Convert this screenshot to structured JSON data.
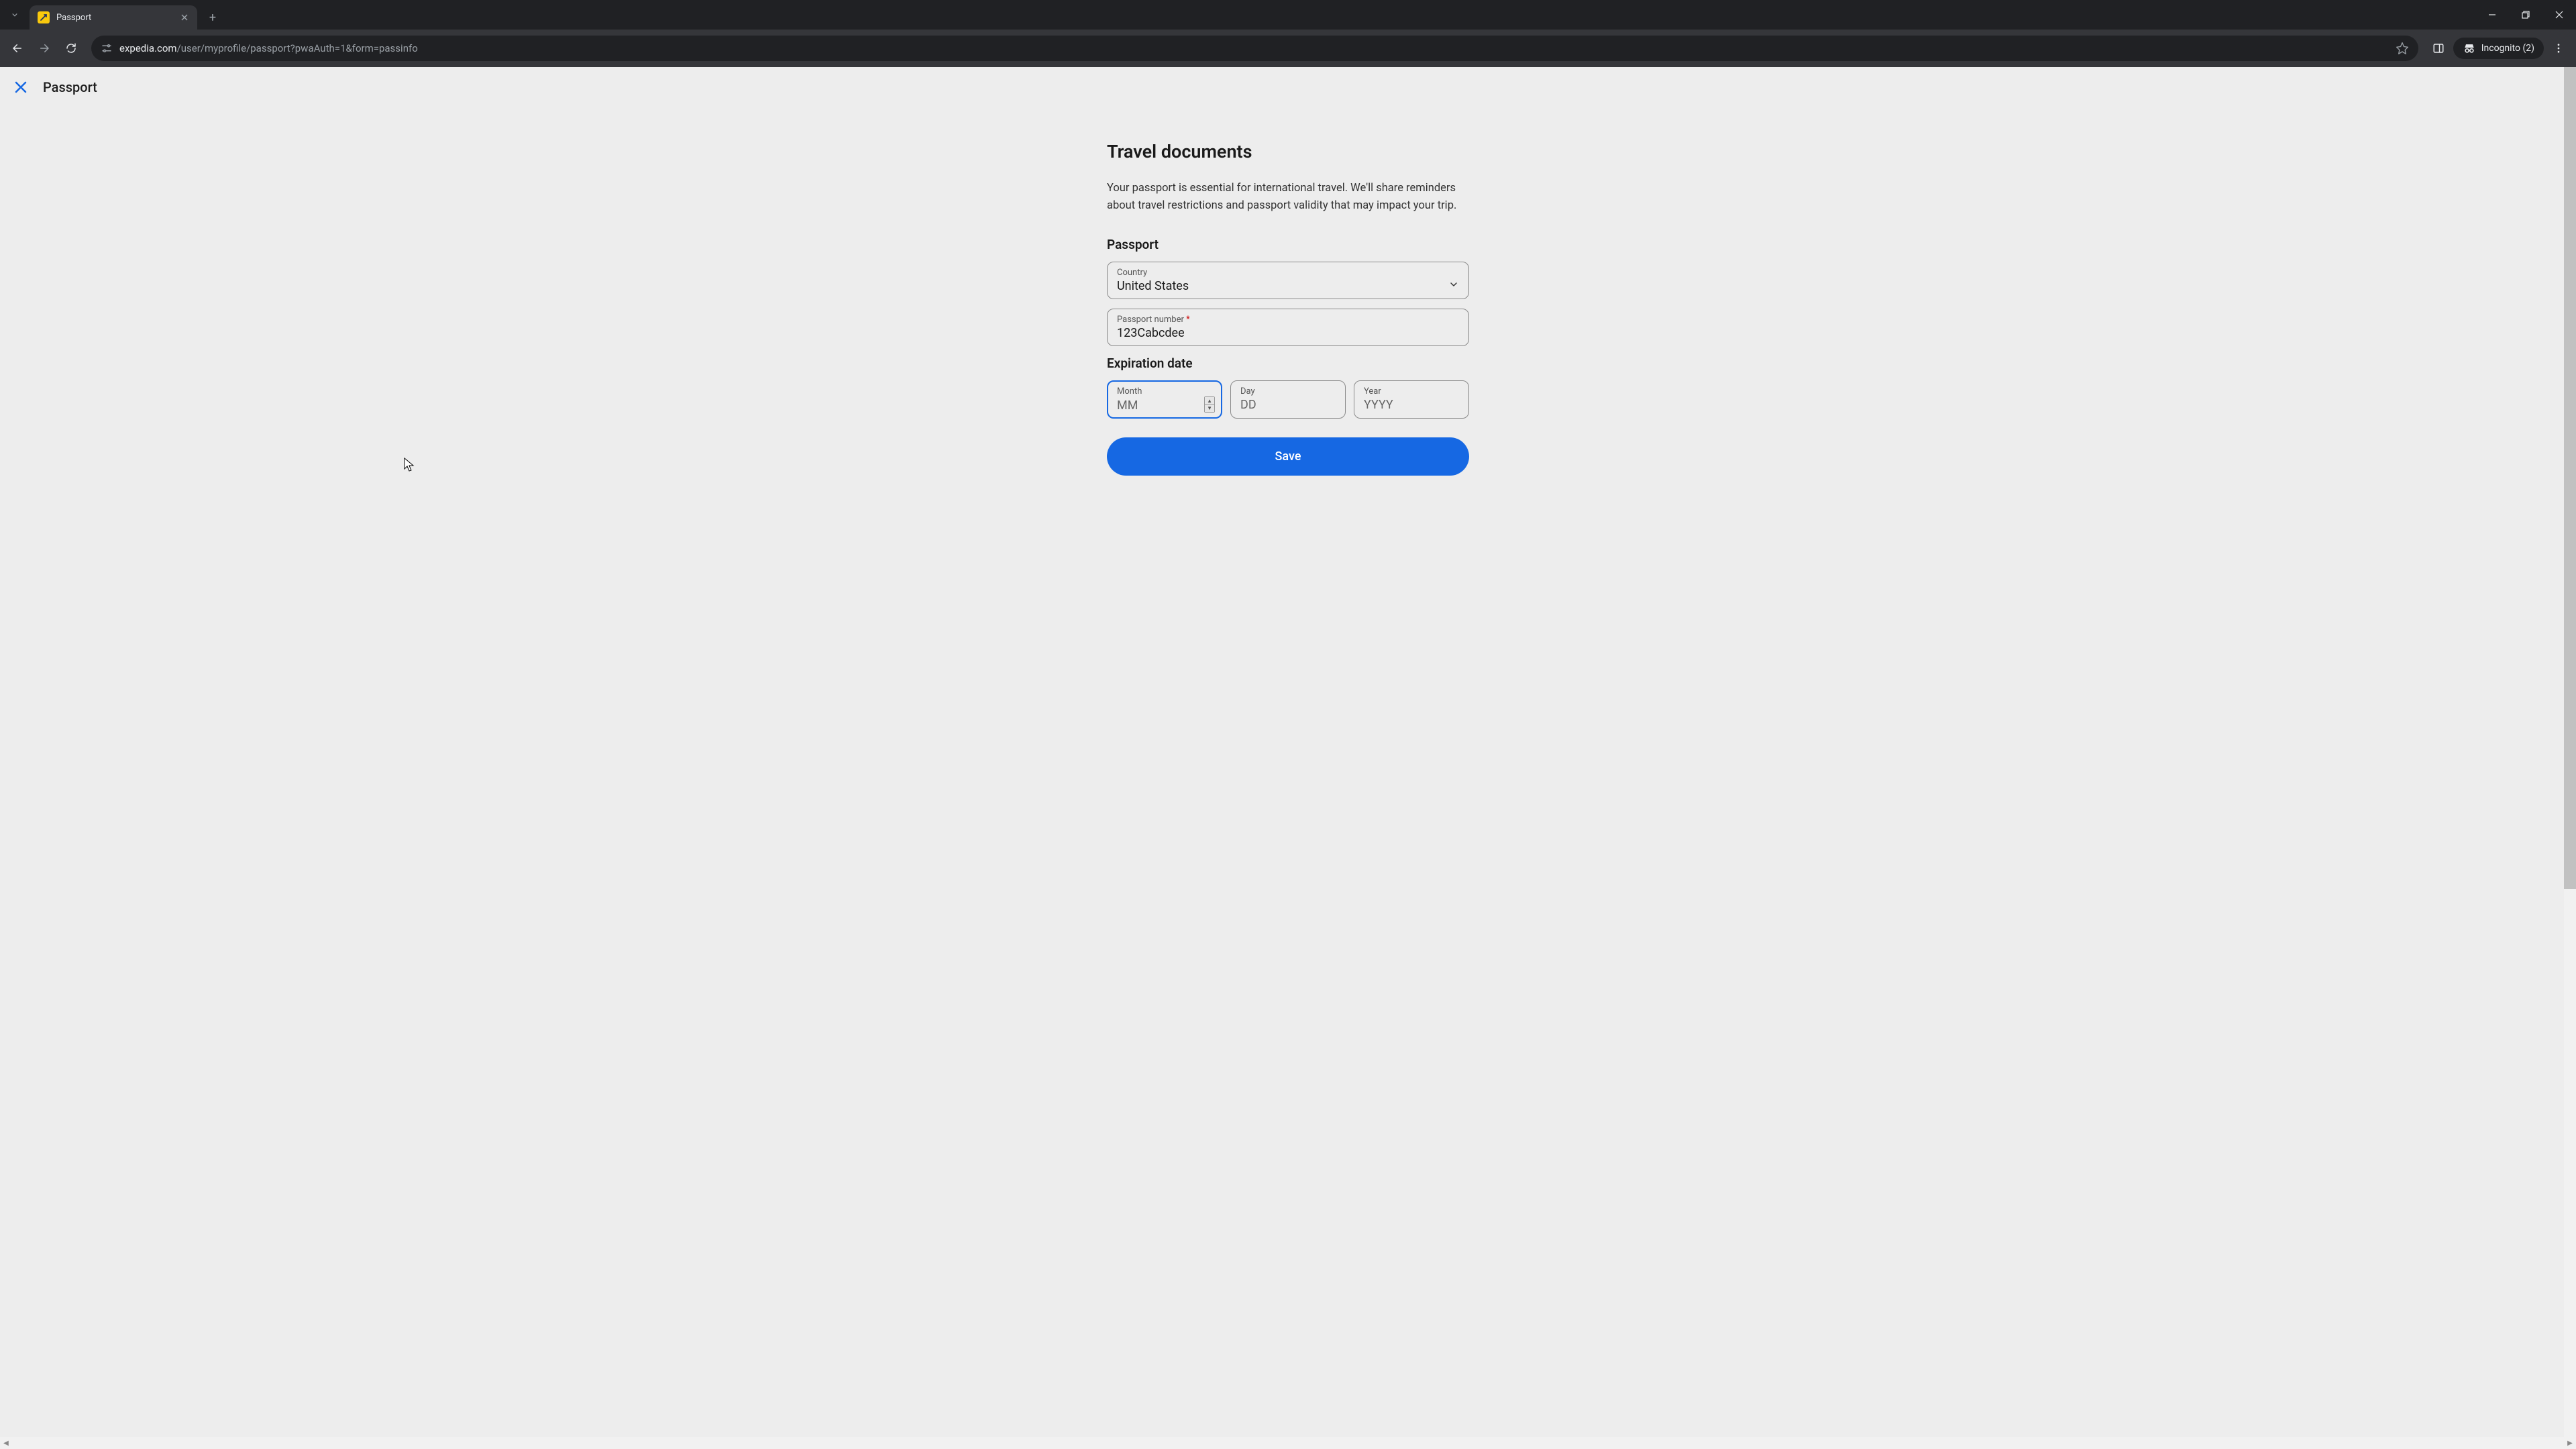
{
  "browser": {
    "tab_title": "Passport",
    "url_domain": "expedia.com",
    "url_path": "/user/myprofile/passport?pwaAuth=1&form=passinfo",
    "incognito_label": "Incognito (2)"
  },
  "page": {
    "header_title": "Passport",
    "h1": "Travel documents",
    "subtext": "Your passport is essential for international travel. We'll share reminders about travel restrictions and passport validity that may impact your trip.",
    "passport_section_label": "Passport",
    "country": {
      "label": "Country",
      "value": "United States"
    },
    "passport_number": {
      "label": "Passport number",
      "required_mark": "*",
      "value": "123Cabcdee"
    },
    "expiration_section_label": "Expiration date",
    "month": {
      "label": "Month",
      "placeholder": "MM",
      "value": ""
    },
    "day": {
      "label": "Day",
      "placeholder": "DD",
      "value": ""
    },
    "year": {
      "label": "Year",
      "placeholder": "YYYY",
      "value": ""
    },
    "save_label": "Save"
  }
}
